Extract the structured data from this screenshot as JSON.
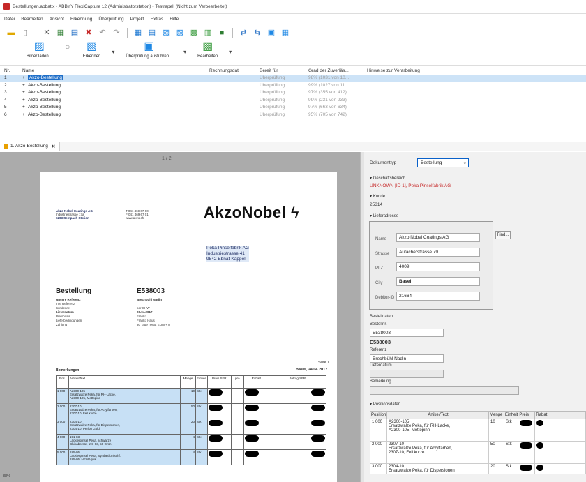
{
  "window": {
    "title": "Bestellungen.abbatix - ABBYY FlexiCapture 12 (Administratorstation) - Testrapell (Nicht zum Verbeerbeitet)"
  },
  "menu": [
    "Datei",
    "Bearbeiten",
    "Ansicht",
    "Erkennung",
    "Überprüfung",
    "Projekt",
    "Extras",
    "Hilfe"
  ],
  "qat_icons": [
    "folder-open-icon",
    "page-icon",
    "close-x-icon",
    "tool-icon",
    "batch-icon",
    "delete-x-icon",
    "undo-icon",
    "redo-icon",
    "grid-view-icon",
    "list-view-icon",
    "scan-icon",
    "recognize-icon",
    "export-icon",
    "import-icon",
    "green-check-icon",
    "arrows-icon",
    "arrows2-icon",
    "form-icon",
    "stats-icon"
  ],
  "ribbon": {
    "buttons": [
      {
        "icon": "add-images-icon",
        "label": "Bilder laden..."
      },
      {
        "icon": "recognize-circle-icon",
        "label": ""
      },
      {
        "icon": "recognize-images-icon",
        "label": "Erkennen"
      },
      {
        "icon": "check-icon",
        "label": "Überprüfung ausführen..."
      },
      {
        "icon": "edit-icon",
        "label": "Bearbeiten"
      }
    ]
  },
  "grid": {
    "headers": [
      "Nr.",
      "Name",
      "Rechnungsdat",
      "Bereit für",
      "Grad der Zuverläs...",
      "Hinweise zur Verarbeitung"
    ],
    "rows": [
      {
        "nr": "1",
        "name": "Akzo-Bestellung",
        "status": "Überprüfung",
        "grad": "98% (1031 von 10..."
      },
      {
        "nr": "2",
        "name": "Akzo-Bestellung",
        "status": "Überprüfung",
        "grad": "99% (1027 von 11..."
      },
      {
        "nr": "3",
        "name": "Akzo-Bestellung",
        "status": "Überprüfung",
        "grad": "97% (355 von 412)"
      },
      {
        "nr": "4",
        "name": "Akzo-Bestellung",
        "status": "Überprüfung",
        "grad": "99% (231 von 233)"
      },
      {
        "nr": "5",
        "name": "Akzo-Bestellung",
        "status": "Überprüfung",
        "grad": "97% (663 von 634)"
      },
      {
        "nr": "6",
        "name": "Akzo-Bestellung",
        "status": "Überprüfung",
        "grad": "95% (705 von 742)"
      }
    ]
  },
  "doctab": {
    "label": "1. Akzo-Bestellung"
  },
  "viewer": {
    "page_indicator": "1 / 2",
    "logo": "AkzoNobel",
    "sender": [
      "Akzo Nobel Coatings AG",
      "Industriestrasse 17a",
      "6203 Sempach Station"
    ],
    "phone": [
      "T 041 469 67 00",
      "F 041 469 67 01",
      "www.akzo.ch"
    ],
    "recipient": [
      "Peka Pinselfabrik AG",
      "Industriestrasse 41",
      "9542 Ebnat-Kappel"
    ],
    "order_title": "Bestellung",
    "order_no": "E538003",
    "labels": [
      "Unsere Referenz",
      "Ihre Referenz",
      "Kundennr.",
      "Lieferdatum",
      "Preisbasis",
      "Lieferbedingungen",
      "Zahlung"
    ],
    "values": [
      "Brechbühl Nadin",
      "",
      "per CHW",
      "26.04.2017",
      "Franko",
      "Franko Haus",
      "30 Tage netto, EOM + 8"
    ],
    "remarks_label": "Bemerkungen",
    "page_label": "Seite 1",
    "place_date": "Basel, 24.04.2017",
    "table_headers": [
      "Pos.",
      "Artikel/Text",
      "Menge",
      "Einheit",
      "Preis SFR",
      "pro",
      "Rabatt",
      "Betrag SFR"
    ],
    "table_rows": [
      {
        "pos": "1 000",
        "text": [
          "A2300-105",
          "Ersatzwalze Peka, für RH-Lacke,",
          "A2300-105, Mottopinn"
        ],
        "qty": "10",
        "unit": "Stk"
      },
      {
        "pos": "2 000",
        "text": [
          "2307-10",
          "Ersatzwalze Peka, für Acrylfarben,",
          "2307-10, Fell kurze"
        ],
        "qty": "50",
        "unit": "Stk"
      },
      {
        "pos": "3 000",
        "text": [
          "2304-10",
          "Ersatzwalze Peka, für Dispersionen,",
          "2304-10, Perlon Gold"
        ],
        "qty": "20",
        "unit": "Stk"
      },
      {
        "pos": "4 000",
        "text": [
          "191-83",
          "Lackierpinsel Peka, schwarze",
          "Chinaborste, 191-83, 50 Grün"
        ],
        "qty": "4",
        "unit": "Stk"
      },
      {
        "pos": "5 000",
        "text": [
          "185-05",
          "Lackierpinsel Peka, Synthetikmischf.",
          "185-05, NEWAqua"
        ],
        "qty": "4",
        "unit": "Stk"
      }
    ],
    "zoom": "38%"
  },
  "panel": {
    "doctype_label": "Dokumenttyp",
    "doctype_value": "Bestellung",
    "section_business": "Geschäftsbereich",
    "business_value": "UNKNOWN [ID 1], Peka Pinselfabrik AG",
    "section_customer": "Kunde",
    "customer_value": "25314",
    "section_supplier": "Lieferadresse",
    "supplier_rows": [
      {
        "label": "Name",
        "value": "Akzo Nobel Coatings AG"
      },
      {
        "label": "Strasse",
        "value": "Aufacherstrasse 79"
      },
      {
        "label": "PLZ",
        "value": "4009"
      },
      {
        "label": "City",
        "value": "Basel"
      },
      {
        "label": "Debitor-ID",
        "value": "21664"
      }
    ],
    "find_button": "Find...",
    "section_order": "Bestelldaten",
    "order_no_label": "Bestellnr.",
    "order_no_value": "E538003",
    "order_no_bold": "E538003",
    "reference_label": "Referenz",
    "reference_value": "Brechbühl Nadin",
    "delivery_label": "Lieferdatum",
    "remark_label": "Bemerkung",
    "section_positions": "Positionsdaten",
    "pos_headers": [
      "Position",
      "Artikel/Text",
      "Menge",
      "Einheit",
      "Preis",
      "Rabat"
    ],
    "pos_rows": [
      {
        "pos": "1 000",
        "code": "A2300-105",
        "lines": [
          "Ersatzwalze Peka, für RH-Lacke,",
          "A2300-105, Mottopinn"
        ],
        "qty": "10",
        "unit": "Stk"
      },
      {
        "pos": "2 000",
        "code": "2307-10",
        "lines": [
          "Ersatzwalze Peka, für Acrylfarben,",
          "2307-10, Fell kurze"
        ],
        "qty": "50",
        "unit": "Stk"
      },
      {
        "pos": "3 000",
        "code": "2304-10",
        "lines": [
          "Ersatzwalze Peka, für Dispersionen"
        ],
        "qty": "20",
        "unit": "Stk"
      }
    ]
  }
}
